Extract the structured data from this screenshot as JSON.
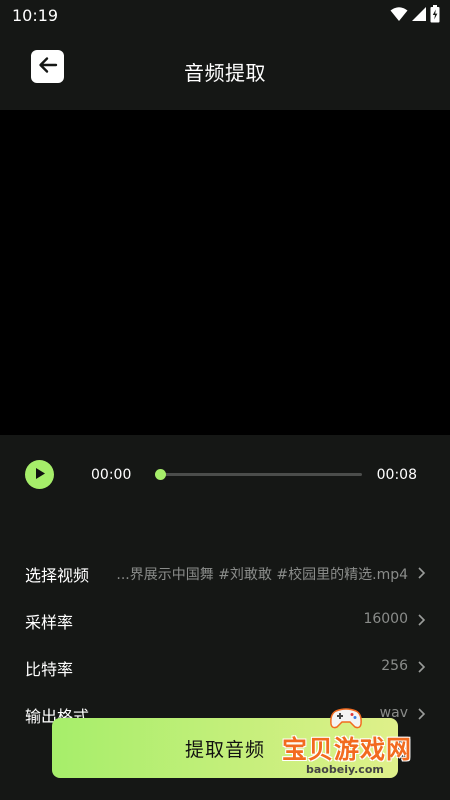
{
  "status_bar": {
    "time": "10:19",
    "icons": [
      "wifi-icon",
      "signal-icon",
      "battery-icon"
    ]
  },
  "header": {
    "back_icon": "arrow-left-icon",
    "title": "音频提取"
  },
  "player": {
    "play_icon": "play-icon",
    "current_time": "00:00",
    "total_time": "00:08",
    "progress": 0.0,
    "accent": "#a6ee6a"
  },
  "settings": [
    {
      "label": "选择视频",
      "value": "...界展示中国舞 #刘敢敢 #校园里的精选.mp4"
    },
    {
      "label": "采样率",
      "value": "16000"
    },
    {
      "label": "比特率",
      "value": "256"
    },
    {
      "label": "输出格式",
      "value": "wav"
    }
  ],
  "action": {
    "label": "提取音频"
  },
  "watermark": {
    "text": "宝贝游戏网",
    "url": "baobeiy.com"
  },
  "colors": {
    "background": "#151715",
    "accent": "#a6ee6a",
    "muted_text": "#8a8c8a"
  }
}
